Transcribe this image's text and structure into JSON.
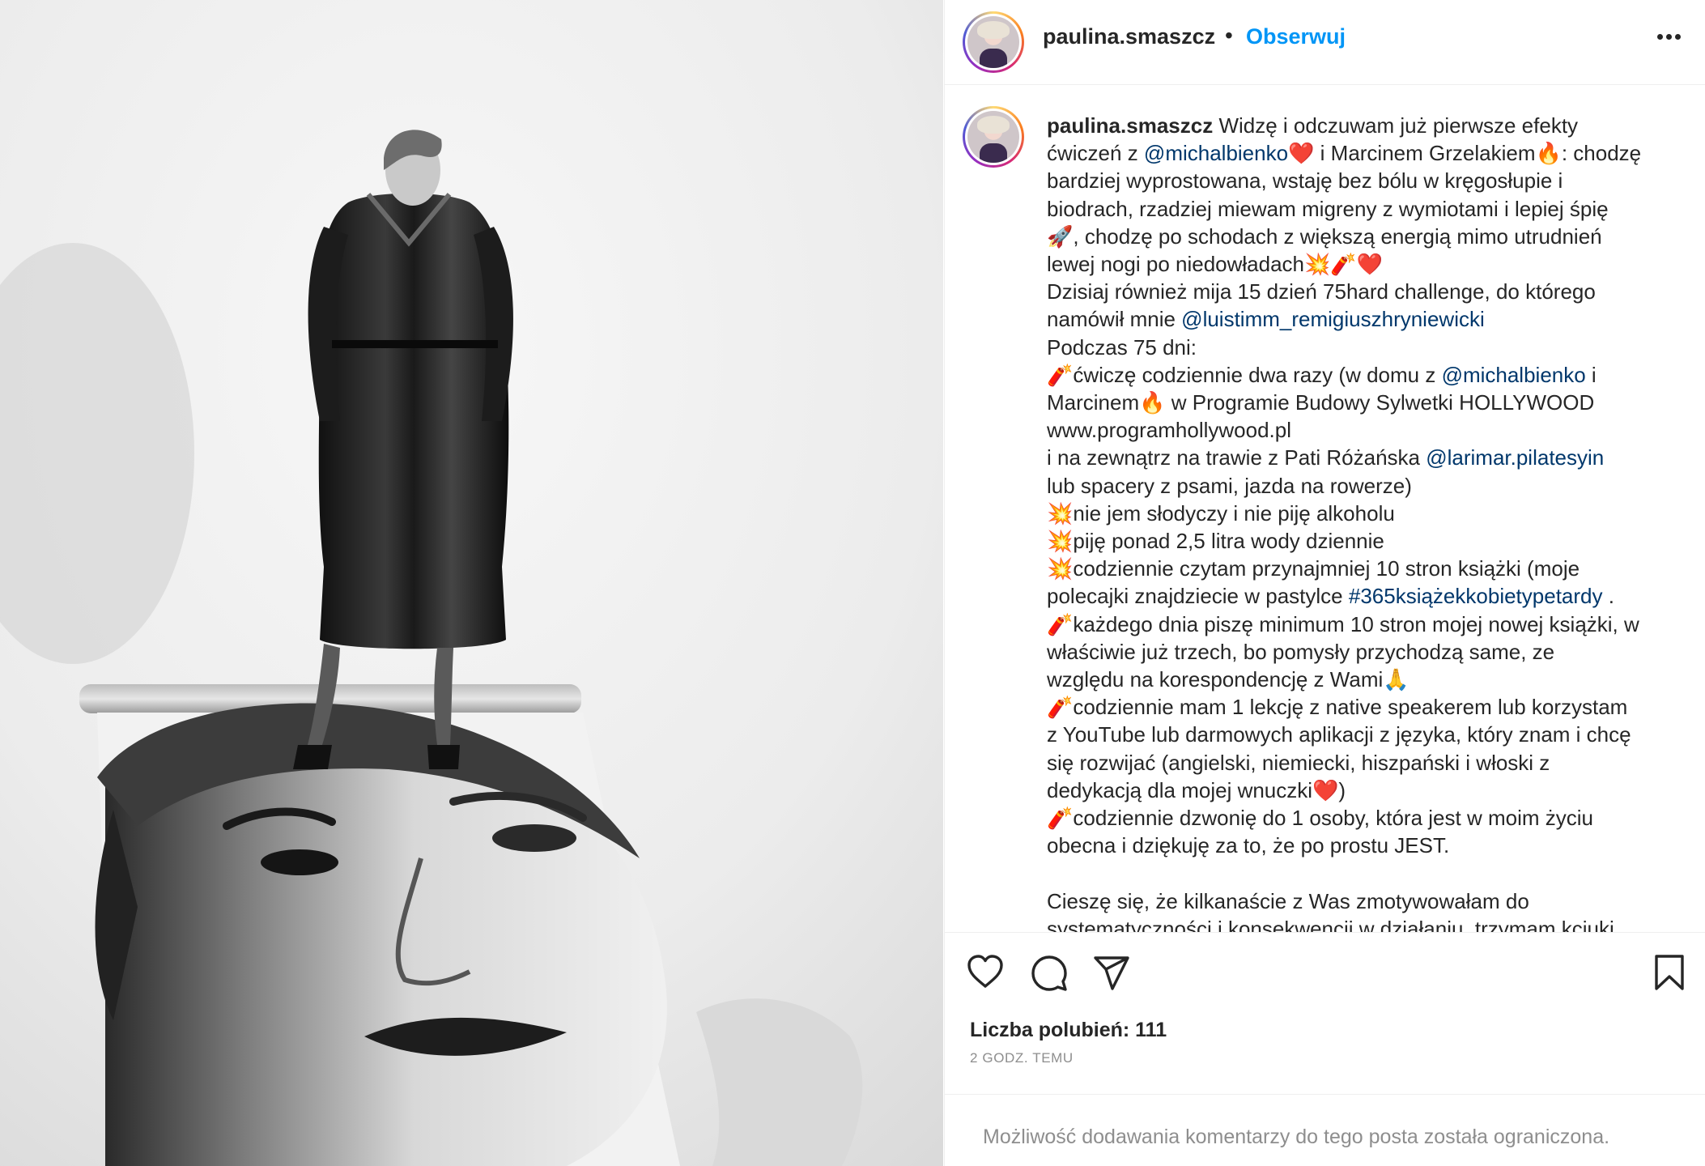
{
  "post": {
    "username": "paulina.smaszcz",
    "separator": "•",
    "follow_label": "Obserwuj",
    "more_icon": "more-horizontal-icon",
    "avatar_alt": "profile-photo"
  },
  "caption": {
    "username": "paulina.smaszcz",
    "lines": [
      [
        {
          "t": "Widzę i odczuwam już pierwsze efekty"
        }
      ],
      [
        {
          "t": "ćwiczeń z "
        },
        {
          "t": "@michalbienko",
          "link": true
        },
        {
          "t": "❤️ i Marcinem Grzelakiem🔥: chodzę"
        }
      ],
      [
        {
          "t": "bardziej wyprostowana, wstaję bez bólu w kręgosłupie i"
        }
      ],
      [
        {
          "t": "biodrach, rzadziej miewam migreny z wymiotami i lepiej śpię"
        }
      ],
      [
        {
          "t": "🚀, chodzę po schodach z większą energią mimo utrudnień"
        }
      ],
      [
        {
          "t": "lewej nogi po niedowładach💥🧨❤️"
        }
      ],
      [
        {
          "t": "Dzisiaj również mija 15 dzień 75hard challenge, do którego"
        }
      ],
      [
        {
          "t": "namówił mnie "
        },
        {
          "t": "@luistimm_remigiuszhryniewicki",
          "link": true
        }
      ],
      [
        {
          "t": "Podczas 75 dni:"
        }
      ],
      [
        {
          "t": "🧨ćwiczę codziennie dwa razy (w domu z "
        },
        {
          "t": "@michalbienko",
          "link": true
        },
        {
          "t": " i"
        }
      ],
      [
        {
          "t": "Marcinem🔥 w Programie Budowy Sylwetki HOLLYWOOD"
        }
      ],
      [
        {
          "t": "www.programhollywood.pl"
        }
      ],
      [
        {
          "t": "i na zewnątrz na trawie z Pati Różańska "
        },
        {
          "t": "@larimar.pilatesyin",
          "link": true
        }
      ],
      [
        {
          "t": "lub spacery z psami, jazda na rowerze)"
        }
      ],
      [
        {
          "t": "💥nie jem słodyczy i nie piję alkoholu"
        }
      ],
      [
        {
          "t": "💥piję ponad 2,5 litra wody dziennie"
        }
      ],
      [
        {
          "t": "💥codziennie czytam przynajmniej 10 stron książki (moje"
        }
      ],
      [
        {
          "t": "polecajki znajdziecie w pastylce "
        },
        {
          "t": "#365książekkobietypetardy",
          "link": true
        },
        {
          "t": " ."
        }
      ],
      [
        {
          "t": "🧨każdego dnia piszę minimum 10 stron mojej nowej książki, w"
        }
      ],
      [
        {
          "t": "właściwie już trzech, bo pomysły przychodzą same, ze"
        }
      ],
      [
        {
          "t": "względu na korespondencję z Wami🙏"
        }
      ],
      [
        {
          "t": "🧨codziennie mam 1 lekcję z native speakerem lub korzystam"
        }
      ],
      [
        {
          "t": "z YouTube lub darmowych aplikacji z języka, który znam i chcę"
        }
      ],
      [
        {
          "t": "się rozwijać (angielski, niemiecki, hiszpański i włoski z"
        }
      ],
      [
        {
          "t": "dedykacją dla mojej wnuczki❤️)"
        }
      ],
      [
        {
          "t": "🧨codziennie dzwonię do 1 osoby, która jest w moim życiu"
        }
      ],
      [
        {
          "t": "obecna i dziękuję za to, że po prostu JEST."
        }
      ],
      [
        {
          "t": ""
        }
      ],
      [
        {
          "t": "Cieszę się, że kilkanaście z Was zmotywowałam do"
        }
      ],
      [
        {
          "t": "systematyczności i konsekwencji w działaniu, trzymam kciuki"
        }
      ]
    ]
  },
  "actions": {
    "like_icon": "heart-icon",
    "comment_icon": "comment-icon",
    "share_icon": "share-icon",
    "save_icon": "bookmark-icon",
    "likes_label": "Liczba polubień: 111",
    "time_label": "2 GODZ. TEMU"
  },
  "comments": {
    "restricted_message": "Możliwość dodawania komentarzy do tego posta została ograniczona."
  },
  "colors": {
    "accent": "#0095f6",
    "link": "#00376b",
    "text": "#262626",
    "muted": "#8e8e8e",
    "divider": "#efefef"
  }
}
